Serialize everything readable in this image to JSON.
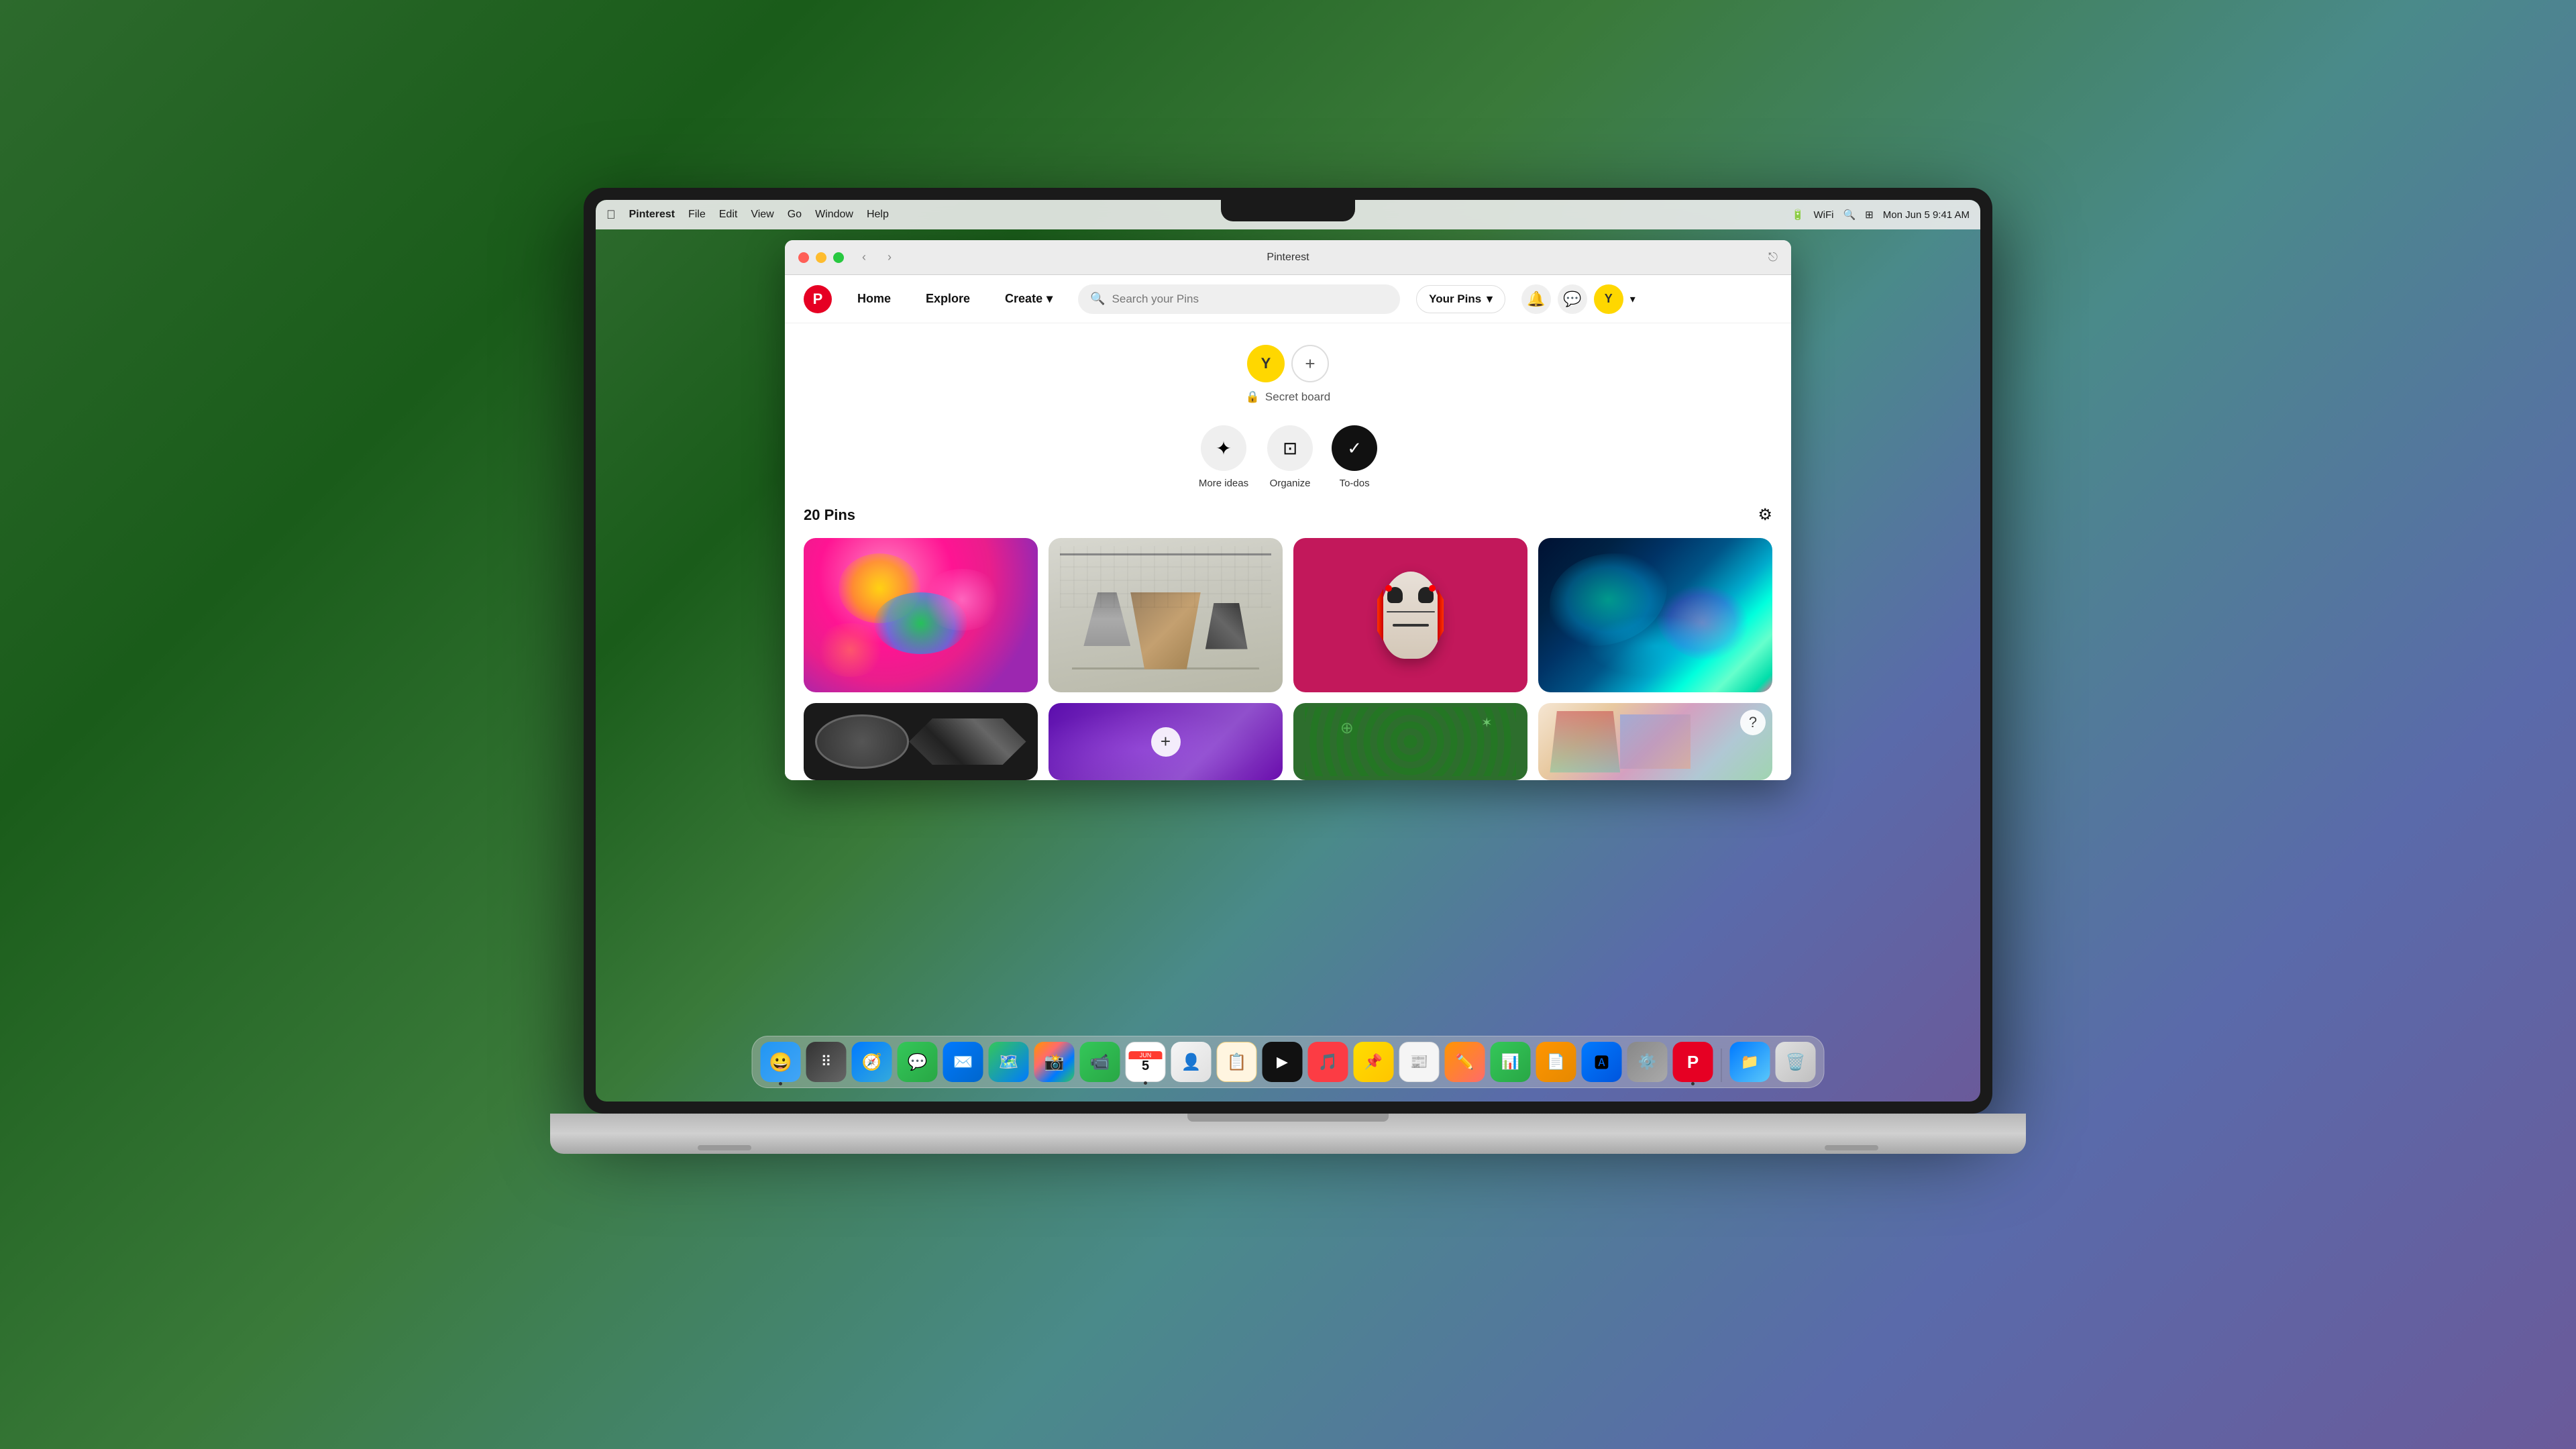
{
  "system": {
    "time": "Mon Jun 5  9:41 AM",
    "menu_bar": {
      "apple": "🍎",
      "app": "Pinterest",
      "items": [
        "File",
        "Edit",
        "View",
        "Go",
        "Window",
        "Help"
      ]
    }
  },
  "browser": {
    "title": "Pinterest",
    "back_label": "‹",
    "forward_label": "›"
  },
  "pinterest": {
    "nav": {
      "home_label": "Home",
      "explore_label": "Explore",
      "create_label": "Create",
      "search_placeholder": "Search your Pins",
      "your_pins_label": "Your Pins"
    },
    "board": {
      "avatar_letter": "Y",
      "secret_label": "Secret board"
    },
    "actions": [
      {
        "id": "more-ideas",
        "label": "More ideas",
        "icon": "✦"
      },
      {
        "id": "organize",
        "label": "Organize",
        "icon": "⊡"
      },
      {
        "id": "to-dos",
        "label": "To-dos",
        "icon": "✓"
      }
    ],
    "pins_count": "20 Pins",
    "pins": [
      {
        "id": 1,
        "type": "balloon-art",
        "alt": "Colorful balloon sculpture"
      },
      {
        "id": 2,
        "type": "room-art",
        "alt": "3D rendered room"
      },
      {
        "id": 3,
        "type": "mask-art",
        "alt": "Abstract mask on red"
      },
      {
        "id": 4,
        "type": "fluid-art",
        "alt": "Colorful fluid simulation"
      },
      {
        "id": 5,
        "type": "mech-art",
        "alt": "Mechanical parts"
      },
      {
        "id": 6,
        "type": "purple-art",
        "alt": "Purple gradient"
      },
      {
        "id": 7,
        "type": "green-art",
        "alt": "Green geometric pattern"
      },
      {
        "id": 8,
        "type": "pastel-art",
        "alt": "Pastel abstract"
      }
    ]
  },
  "dock": {
    "apps": [
      {
        "id": "finder",
        "icon": "🔵",
        "label": "Finder",
        "active": true
      },
      {
        "id": "launchpad",
        "icon": "🟠",
        "label": "Launchpad"
      },
      {
        "id": "safari",
        "icon": "🧭",
        "label": "Safari"
      },
      {
        "id": "messages",
        "icon": "💬",
        "label": "Messages"
      },
      {
        "id": "mail",
        "icon": "✉️",
        "label": "Mail"
      },
      {
        "id": "maps",
        "icon": "🗺️",
        "label": "Maps"
      },
      {
        "id": "photos",
        "icon": "📷",
        "label": "Photos"
      },
      {
        "id": "facetime",
        "icon": "📹",
        "label": "FaceTime"
      },
      {
        "id": "calendar",
        "icon": "📅",
        "label": "Calendar"
      },
      {
        "id": "contacts",
        "icon": "👤",
        "label": "Contacts"
      },
      {
        "id": "reminders",
        "icon": "📋",
        "label": "Reminders"
      },
      {
        "id": "appletv",
        "icon": "📺",
        "label": "Apple TV"
      },
      {
        "id": "music",
        "icon": "🎵",
        "label": "Music"
      },
      {
        "id": "miro",
        "icon": "📌",
        "label": "Miro"
      },
      {
        "id": "news",
        "icon": "📰",
        "label": "News"
      },
      {
        "id": "textedit",
        "icon": "🖊️",
        "label": "TextEdit"
      },
      {
        "id": "numbers",
        "icon": "📊",
        "label": "Numbers"
      },
      {
        "id": "pages",
        "icon": "📄",
        "label": "Pages"
      },
      {
        "id": "appstore",
        "icon": "🅰️",
        "label": "App Store"
      },
      {
        "id": "settings",
        "icon": "⚙️",
        "label": "System Settings"
      },
      {
        "id": "pinterest",
        "icon": "🅿️",
        "label": "Pinterest",
        "active": true
      },
      {
        "id": "folder",
        "icon": "📁",
        "label": "Downloads"
      },
      {
        "id": "trash",
        "icon": "🗑️",
        "label": "Trash"
      }
    ]
  }
}
